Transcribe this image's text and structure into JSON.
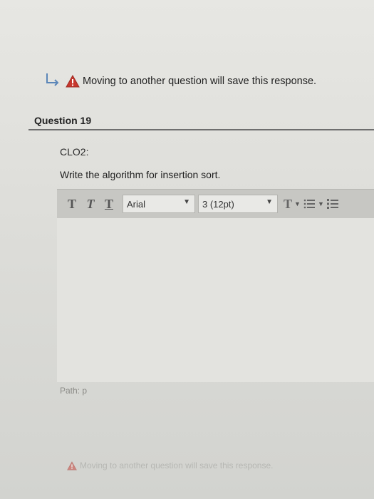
{
  "warning_top": {
    "text": "Moving to another question will save this response."
  },
  "question": {
    "title": "Question 19"
  },
  "content": {
    "clo": "CLO2:",
    "prompt": "Write the algorithm for insertion sort."
  },
  "toolbar": {
    "bold": "T",
    "italic": "T",
    "underline": "T",
    "font_family": "Arial",
    "font_size": "3 (12pt)",
    "text_color": "T",
    "dropdown_glyph": "▼"
  },
  "editor": {
    "path_label": "Path: p"
  },
  "warning_bottom": {
    "text": "Moving to another question will save this response."
  }
}
